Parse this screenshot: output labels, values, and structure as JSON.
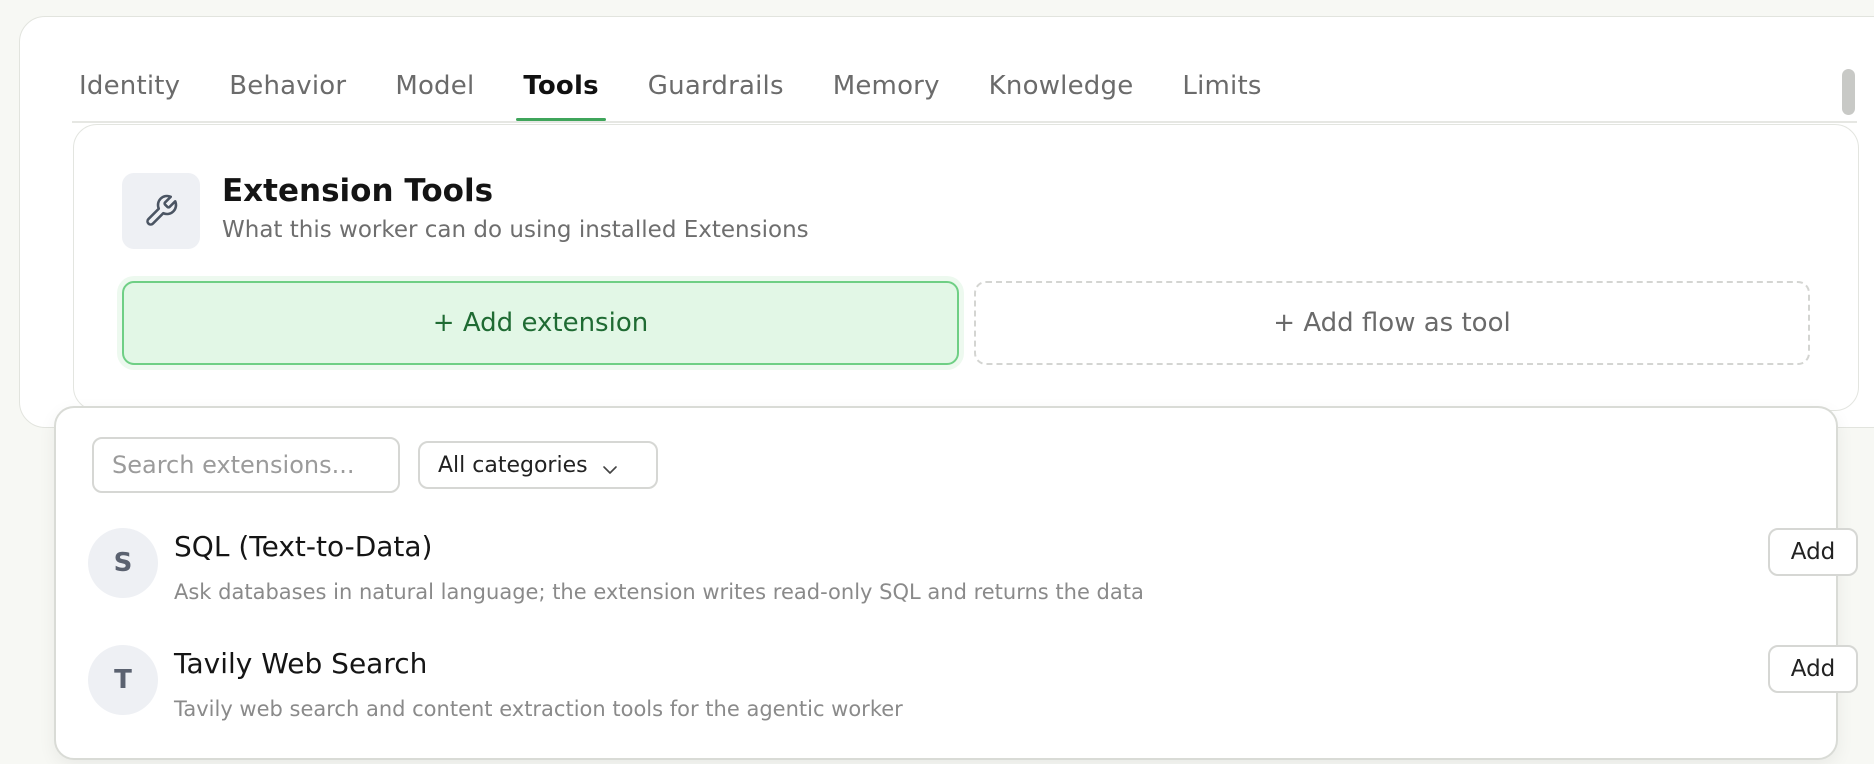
{
  "tabs": [
    {
      "label": "Identity"
    },
    {
      "label": "Behavior"
    },
    {
      "label": "Model"
    },
    {
      "label": "Tools",
      "active": true
    },
    {
      "label": "Guardrails"
    },
    {
      "label": "Memory"
    },
    {
      "label": "Knowledge"
    },
    {
      "label": "Limits"
    }
  ],
  "extension_tools": {
    "icon": "wrench-icon",
    "title": "Extension Tools",
    "subtitle": "What this worker can do using installed Extensions",
    "add_extension_label": "+ Add extension",
    "add_flow_label": "+ Add flow as tool"
  },
  "picker": {
    "search_placeholder": "Search extensions...",
    "category_selected": "All categories",
    "items": [
      {
        "avatar": "S",
        "name": "SQL (Text-to-Data)",
        "description": "Ask databases in natural language; the extension writes read-only SQL and returns the data",
        "action_label": "Add"
      },
      {
        "avatar": "T",
        "name": "Tavily Web Search",
        "description": "Tavily web search and content extraction tools for the agentic worker",
        "action_label": "Add"
      }
    ]
  },
  "colors": {
    "accent": "#3fa55b",
    "add_extension_bg": "#e2f7e6",
    "add_extension_text": "#1f6b33"
  }
}
